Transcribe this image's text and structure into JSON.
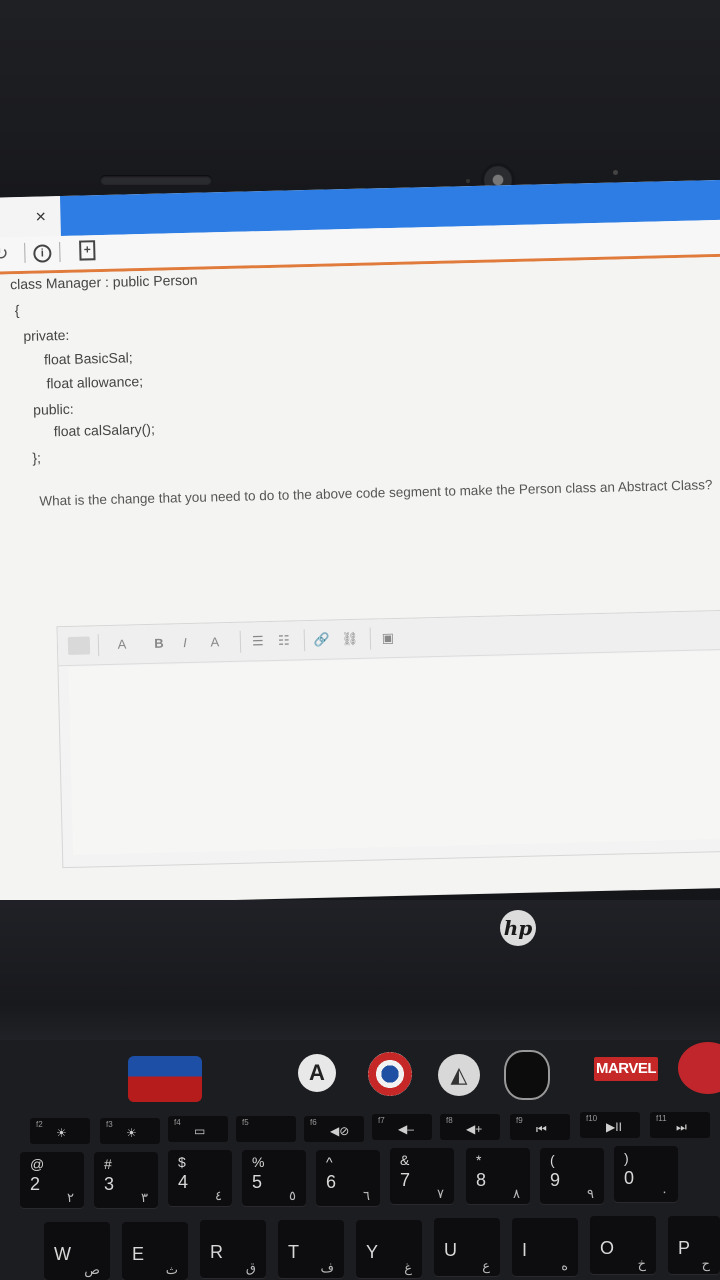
{
  "window": {
    "close_glyph": "×"
  },
  "toolbar": {
    "reload_glyph": "↻",
    "info_glyph": "i",
    "add_page_glyph": "+"
  },
  "code_lines": [
    "class Manager : public Person",
    "{",
    "private:",
    "float BasicSal;",
    "float allowance;",
    "public:",
    "float calSalary();",
    "};"
  ],
  "question": "What is the change that you need to do to the above code segment to make the Person class an Abstract Class?",
  "editor_toolbar": {
    "paragraph_glyph": "A",
    "bold": "B",
    "italic": "I",
    "font_color": "A",
    "bullet_list_glyph": "☰",
    "numbered_list_glyph": "☷",
    "link_glyph": "🔗",
    "unlink_glyph": "⛓",
    "image_glyph": "▣"
  },
  "cursor_glyph": "⇖",
  "laptop": {
    "brand": "hp",
    "stickers": {
      "marvel": "MARVEL",
      "avengers": "A",
      "ironman": "◭"
    }
  },
  "keyboard": {
    "function_row": [
      {
        "label": "f2",
        "icon": "☀"
      },
      {
        "label": "f3",
        "icon": "☀"
      },
      {
        "label": "f4",
        "icon": "▭"
      },
      {
        "label": "f5",
        "icon": ""
      },
      {
        "label": "f6",
        "icon": "◀⊘"
      },
      {
        "label": "f7",
        "icon": "◀–"
      },
      {
        "label": "f8",
        "icon": "◀+"
      },
      {
        "label": "f9",
        "icon": "⏮"
      },
      {
        "label": "f10",
        "icon": "▶II"
      },
      {
        "label": "f11",
        "icon": "⏭"
      }
    ],
    "number_row": [
      {
        "shift": "@",
        "main": "2",
        "alt": "٢"
      },
      {
        "shift": "#",
        "main": "3",
        "alt": "٣"
      },
      {
        "shift": "$",
        "main": "4",
        "alt": "٤"
      },
      {
        "shift": "%",
        "main": "5",
        "alt": "٥"
      },
      {
        "shift": "^",
        "main": "6",
        "alt": "٦"
      },
      {
        "shift": "&",
        "main": "7",
        "alt": "٧"
      },
      {
        "shift": "*",
        "main": "8",
        "alt": "٨"
      },
      {
        "shift": "(",
        "main": "9",
        "alt": "٩"
      },
      {
        "shift": ")",
        "main": "0",
        "alt": "٠"
      }
    ],
    "letter_row": [
      {
        "main": "W",
        "alt": "ص"
      },
      {
        "main": "E",
        "alt": "ث"
      },
      {
        "main": "R",
        "alt": "ق"
      },
      {
        "main": "T",
        "alt": "ف"
      },
      {
        "main": "Y",
        "alt": "غ"
      },
      {
        "main": "U",
        "alt": "ع"
      },
      {
        "main": "I",
        "alt": "ه"
      },
      {
        "main": "O",
        "alt": "خ"
      },
      {
        "main": "P",
        "alt": "ح"
      }
    ]
  }
}
